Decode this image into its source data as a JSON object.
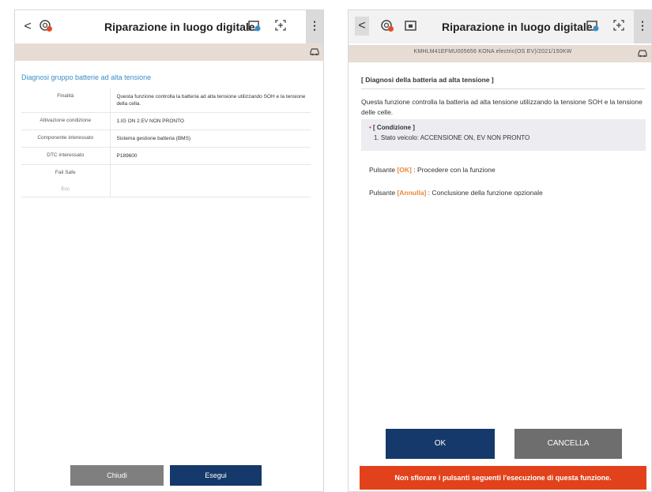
{
  "left": {
    "header": {
      "back": "<",
      "title": "Riparazione in luogo digitale",
      "menu": "⋮"
    },
    "heading": "Diagnosi gruppo batterie ad alta tensione",
    "rows": [
      {
        "key": "Finalità",
        "value": "Questa funzione controlla la batteria ad alta tensione utilizzando SOH e la tensione della cella."
      },
      {
        "key": "Attivazione condizione",
        "value": "1.IG ON 2.EV NON PRONTO"
      },
      {
        "key": "Componente interessato",
        "value": "Sistema gestione batteria (BMS)"
      },
      {
        "key": "DTC interessato",
        "value": "P189600"
      },
      {
        "key": "Fail Safe",
        "value": ""
      },
      {
        "key": "Ecc",
        "value": ""
      }
    ],
    "buttons": {
      "close": "Chiudi",
      "run": "Esegui"
    }
  },
  "right": {
    "header": {
      "back": "<",
      "title": "Riparazione in luogo digitale",
      "menu": "⋮"
    },
    "vehicle": "KMHLM41EFMU005656  KONA electric(OS EV)/2021/150KW",
    "heading": "[ Diagnosi della batteria ad alta tensione ]",
    "description": "Questa funzione controlla la batteria ad alta tensione utilizzando la tensione SOH e la tensione delle celle.",
    "condition": {
      "bullet": "•",
      "title": "[ Condizione ]",
      "line": "1. Stato veicolo: ACCENSIONE ON, EV NON PRONTO"
    },
    "hint_ok": {
      "prefix": "Pulsante ",
      "tag": "[OK]",
      "suffix": " : Procedere con la funzione"
    },
    "hint_cancel": {
      "prefix": "Pulsante ",
      "tag": "[Annulla]",
      "suffix": " : Conclusione della funzione opzionale"
    },
    "buttons": {
      "ok": "OK",
      "cancel": "CANCELLA"
    },
    "warning": "Non sfiorare i pulsanti seguenti l'esecuzione di questa funzione."
  },
  "colors": {
    "accent_blue": "#15396a",
    "link_blue": "#3b8ec7",
    "warning_red": "#e2421b",
    "highlight_orange": "#e7893a",
    "subbar": "#e7dcd3"
  },
  "icons": [
    "back-icon",
    "wrench-timer-icon",
    "ecu-icon",
    "camera-icon",
    "capture-icon",
    "menu-icon",
    "car-icon"
  ]
}
